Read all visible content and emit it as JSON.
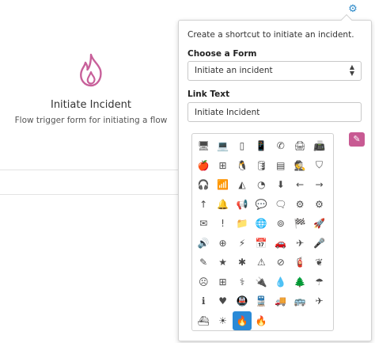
{
  "card": {
    "icon": "fire-icon",
    "title": "Initiate Incident",
    "description": "Flow trigger form for initiating a flow",
    "accent_color": "#c8609a"
  },
  "settings": {
    "icon": "gear-icon",
    "color": "#2d8ac9"
  },
  "popover": {
    "intro": "Create a shortcut to initiate an incident.",
    "form_label": "Choose a Form",
    "form_value": "Initiate an incident",
    "link_label": "Link Text",
    "link_value": "Initiate Incident",
    "pen_button": {
      "icon": "pen-icon",
      "color": "#c85a93"
    },
    "icons": [
      {
        "name": "desktop-icon",
        "glyph": "🖥"
      },
      {
        "name": "laptop-icon",
        "glyph": "💻"
      },
      {
        "name": "tablet-icon",
        "glyph": "▯"
      },
      {
        "name": "mobile-icon",
        "glyph": "📱"
      },
      {
        "name": "phone-icon",
        "glyph": "✆"
      },
      {
        "name": "print-icon",
        "glyph": "🖨"
      },
      {
        "name": "fax-icon",
        "glyph": "📠"
      },
      {
        "name": "apple-icon",
        "glyph": "🍎"
      },
      {
        "name": "windows-icon",
        "glyph": "⊞"
      },
      {
        "name": "linux-icon",
        "glyph": "🐧"
      },
      {
        "name": "database-icon",
        "glyph": "🛢"
      },
      {
        "name": "server-icon",
        "glyph": "▤"
      },
      {
        "name": "user-secret-icon",
        "glyph": "🕵"
      },
      {
        "name": "shield-icon",
        "glyph": "⛉"
      },
      {
        "name": "headphones-icon",
        "glyph": "🎧"
      },
      {
        "name": "signal-icon",
        "glyph": "📶"
      },
      {
        "name": "area-chart-icon",
        "glyph": "◭"
      },
      {
        "name": "dashboard-icon",
        "glyph": "◔"
      },
      {
        "name": "download-icon",
        "glyph": "⬇"
      },
      {
        "name": "arrow-left-icon",
        "glyph": "←"
      },
      {
        "name": "arrow-right-icon",
        "glyph": "→"
      },
      {
        "name": "arrow-up-icon",
        "glyph": "↑"
      },
      {
        "name": "bell-icon",
        "glyph": "🔔"
      },
      {
        "name": "bullhorn-icon",
        "glyph": "📢"
      },
      {
        "name": "comment-icon",
        "glyph": "💬"
      },
      {
        "name": "comments-icon",
        "glyph": "🗨"
      },
      {
        "name": "cog-icon",
        "glyph": "⚙"
      },
      {
        "name": "cogs-icon",
        "glyph": "⚙"
      },
      {
        "name": "envelope-icon",
        "glyph": "✉"
      },
      {
        "name": "exclamation-icon",
        "glyph": "!"
      },
      {
        "name": "folder-icon",
        "glyph": "📁"
      },
      {
        "name": "globe-icon",
        "glyph": "🌐"
      },
      {
        "name": "life-ring-icon",
        "glyph": "⊚"
      },
      {
        "name": "flag-checkered-icon",
        "glyph": "🏁"
      },
      {
        "name": "rocket-icon",
        "glyph": "🚀"
      },
      {
        "name": "volume-up-icon",
        "glyph": "🔊"
      },
      {
        "name": "medkit-icon",
        "glyph": "⊕"
      },
      {
        "name": "bolt-icon",
        "glyph": "⚡"
      },
      {
        "name": "calendar-icon",
        "glyph": "📅"
      },
      {
        "name": "car-icon",
        "glyph": "🚗"
      },
      {
        "name": "paper-plane-icon",
        "glyph": "✈"
      },
      {
        "name": "microphone-icon",
        "glyph": "🎤"
      },
      {
        "name": "pencil-icon",
        "glyph": "✎"
      },
      {
        "name": "star-icon",
        "glyph": "★"
      },
      {
        "name": "asterisk-icon",
        "glyph": "✱"
      },
      {
        "name": "warning-icon",
        "glyph": "⚠"
      },
      {
        "name": "compass-icon",
        "glyph": "⊘"
      },
      {
        "name": "fire-extinguisher-icon",
        "glyph": "🧯"
      },
      {
        "name": "leaf-icon",
        "glyph": "❦"
      },
      {
        "name": "frown-icon",
        "glyph": "☹"
      },
      {
        "name": "first-aid-icon",
        "glyph": "⊞"
      },
      {
        "name": "user-md-icon",
        "glyph": "⚕"
      },
      {
        "name": "plug-icon",
        "glyph": "🔌"
      },
      {
        "name": "tint-icon",
        "glyph": "💧"
      },
      {
        "name": "tree-icon",
        "glyph": "🌲"
      },
      {
        "name": "umbrella-icon",
        "glyph": "☂"
      },
      {
        "name": "info-icon",
        "glyph": "ℹ"
      },
      {
        "name": "heartbeat-icon",
        "glyph": "♥"
      },
      {
        "name": "subway-icon",
        "glyph": "🚇"
      },
      {
        "name": "train-icon",
        "glyph": "🚆"
      },
      {
        "name": "truck-icon",
        "glyph": "🚚"
      },
      {
        "name": "bus-icon",
        "glyph": "🚌"
      },
      {
        "name": "plane-icon",
        "glyph": "✈"
      },
      {
        "name": "ship-icon",
        "glyph": "⛴"
      },
      {
        "name": "sun-icon",
        "glyph": "☀"
      },
      {
        "name": "fire-icon",
        "glyph": "🔥",
        "selected": true
      },
      {
        "name": "fire-small-icon",
        "glyph": "🔥"
      }
    ]
  }
}
